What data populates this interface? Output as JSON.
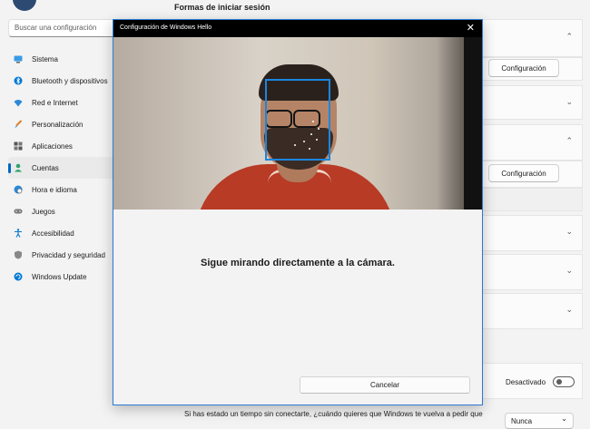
{
  "header": {
    "title": "Formas de iniciar sesión"
  },
  "search": {
    "placeholder": "Buscar una configuración"
  },
  "sidebar": {
    "items": [
      {
        "label": "Sistema",
        "icon": "monitor-icon",
        "color": "#0078d4"
      },
      {
        "label": "Bluetooth y dispositivos",
        "icon": "bluetooth-icon",
        "color": "#0078d4"
      },
      {
        "label": "Red e Internet",
        "icon": "wifi-icon",
        "color": "#0078d4"
      },
      {
        "label": "Personalización",
        "icon": "brush-icon",
        "color": "#e8912d"
      },
      {
        "label": "Aplicaciones",
        "icon": "apps-icon",
        "color": "#505050"
      },
      {
        "label": "Cuentas",
        "icon": "person-icon",
        "color": "#2ea36b",
        "active": true
      },
      {
        "label": "Hora e idioma",
        "icon": "globe-clock-icon",
        "color": "#0078d4"
      },
      {
        "label": "Juegos",
        "icon": "gamepad-icon",
        "color": "#707070"
      },
      {
        "label": "Accesibilidad",
        "icon": "accessibility-icon",
        "color": "#0078d4"
      },
      {
        "label": "Privacidad y seguridad",
        "icon": "shield-icon",
        "color": "#707070"
      },
      {
        "label": "Windows Update",
        "icon": "update-icon",
        "color": "#0078d4"
      }
    ]
  },
  "right_panel": {
    "config_button_1": "Configuración",
    "config_button_2": "Configuración",
    "toggle_state_label": "Desactivado",
    "dropdown_value": "Nunca",
    "bottom_text": "Si has estado un tiempo sin conectarte, ¿cuándo quieres que Windows te vuelva a pedir que"
  },
  "dialog": {
    "title": "Configuración de Windows Hello",
    "close_glyph": "✕",
    "message": "Sigue mirando directamente a la cámara.",
    "cancel_label": "Cancelar"
  },
  "colors": {
    "accent": "#0067c0",
    "face_frame": "#1a86e0",
    "dialog_border": "#2b7ad2"
  }
}
